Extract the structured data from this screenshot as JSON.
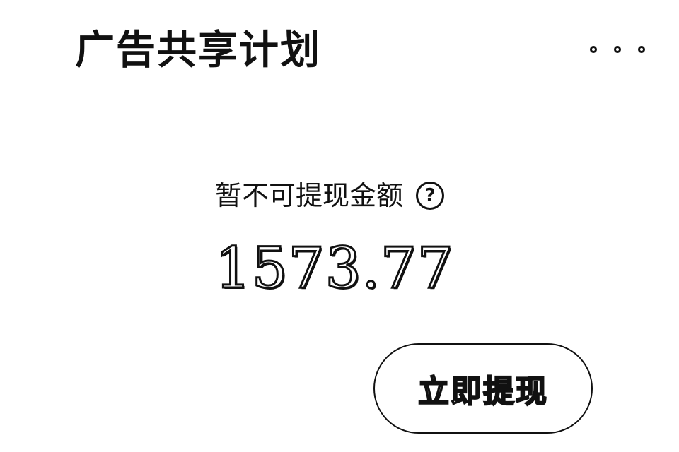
{
  "header": {
    "title": "广告共享计划",
    "more_icon": "more-horizontal-icon"
  },
  "balance": {
    "label": "暂不可提现金额",
    "help_glyph": "?",
    "help_icon": "question-circle-icon",
    "amount": "1573.77"
  },
  "actions": {
    "withdraw_label": "立即提现"
  }
}
